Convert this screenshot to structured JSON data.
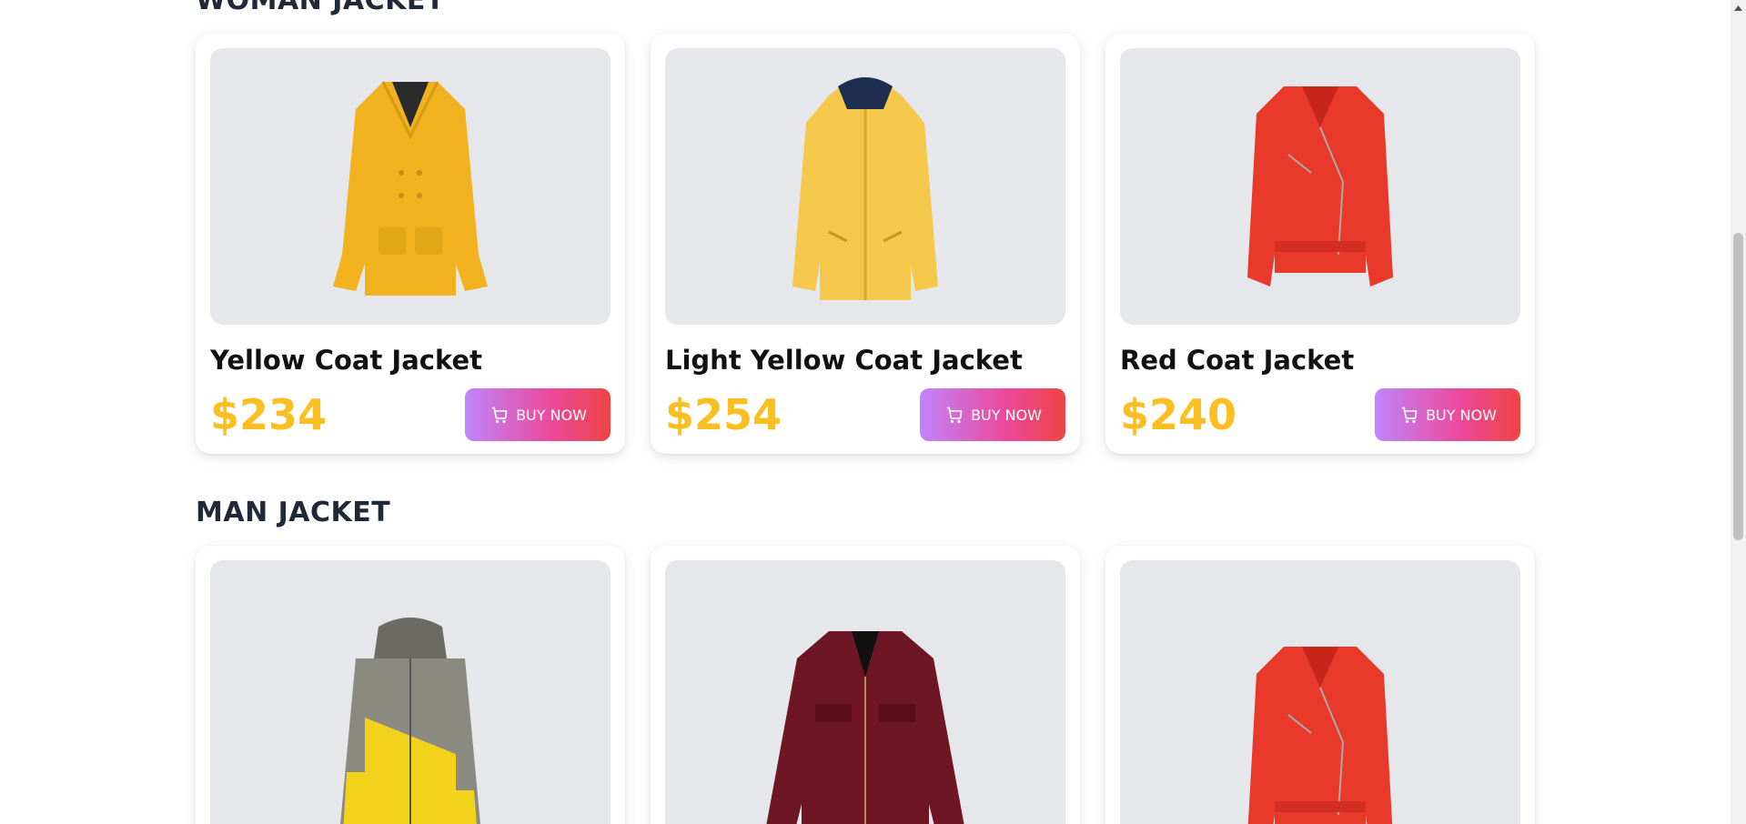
{
  "sections": [
    {
      "title": "WOMAN JACKET",
      "products": [
        {
          "name": "Yellow Coat Jacket",
          "price": "$234",
          "button": "BUY NOW",
          "image": "yellow-coat"
        },
        {
          "name": "Light Yellow Coat Jacket",
          "price": "$254",
          "button": "BUY NOW",
          "image": "light-yellow-raincoat"
        },
        {
          "name": "Red Coat Jacket",
          "price": "$240",
          "button": "BUY NOW",
          "image": "red-biker-jacket"
        }
      ]
    },
    {
      "title": "MAN JACKET",
      "products": [
        {
          "image": "grey-yellow-puffer-jacket"
        },
        {
          "image": "maroon-leather-jacket"
        },
        {
          "image": "red-biker-jacket"
        }
      ]
    }
  ],
  "icons": {
    "buy_button_icon": "cart-icon",
    "scroll_up_icon": "chevron-up-icon"
  },
  "colors": {
    "price": "#fbbf24",
    "button_gradient_start": "#c084fc",
    "button_gradient_end": "#ef4444",
    "image_background": "#e5e7eb"
  }
}
